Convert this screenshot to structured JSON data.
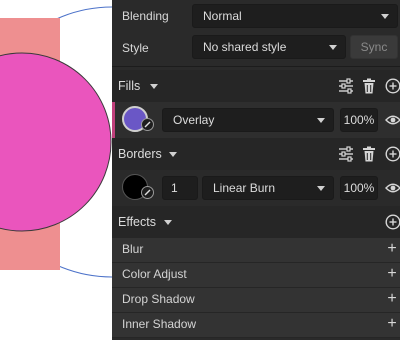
{
  "canvas": {
    "colors": {
      "left_shape": "#ee8f90",
      "pink_circle": "#ea55bd",
      "outline": "#3a3a3a",
      "guide": "#4c72c9"
    }
  },
  "layer": {
    "blending_label": "Blending",
    "blending_value": "Normal",
    "style_label": "Style",
    "style_value": "No shared style",
    "sync_label": "Sync"
  },
  "fills": {
    "title": "Fills",
    "item": {
      "color": "#6a57c6",
      "blend_mode": "Overlay",
      "opacity": "100%"
    }
  },
  "borders": {
    "title": "Borders",
    "item": {
      "color": "#000000",
      "thickness": "1",
      "blend_mode": "Linear Burn",
      "opacity": "100%"
    }
  },
  "effects": {
    "title": "Effects",
    "items": [
      {
        "label": "Blur"
      },
      {
        "label": "Color Adjust"
      },
      {
        "label": "Drop Shadow"
      },
      {
        "label": "Inner Shadow"
      }
    ]
  },
  "icons": {
    "options": "sliders-icon",
    "delete": "trash-icon",
    "add": "plus-circle-icon",
    "visibility": "eye-icon",
    "picker": "eyedropper-icon"
  },
  "theme": {
    "panel_bg": "#2a2a2a",
    "fill_accent": "#c0407c"
  }
}
